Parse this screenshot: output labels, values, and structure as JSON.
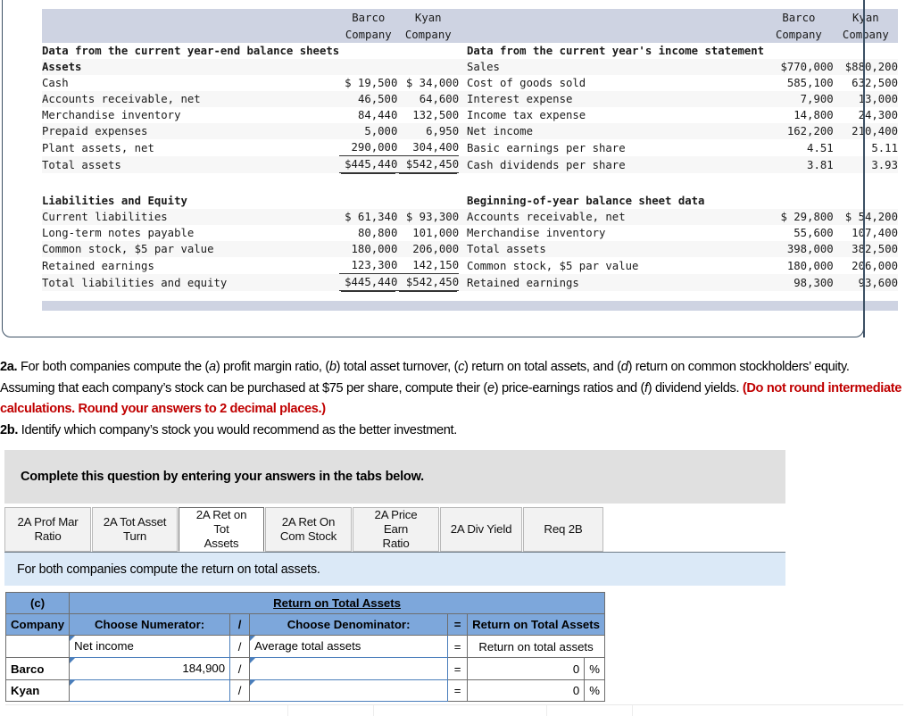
{
  "exhibit": {
    "col_headers": {
      "left_group": [
        {
          "line1": "Barco",
          "line2": "Company"
        },
        {
          "line1": "Kyan",
          "line2": "Company"
        }
      ],
      "right_group": [
        {
          "line1": "Barco",
          "line2": "Company"
        },
        {
          "line1": "Kyan",
          "line2": "Company"
        }
      ]
    },
    "left_section_title": "Data from the current year-end balance sheets",
    "right_section_title": "Data from the current year's income statement",
    "left_subtitle_assets": "Assets",
    "left_subtitle_liab": "Liabilities and Equity",
    "right_subtitle_begin": "Beginning-of-year balance sheet data",
    "assets_rows": [
      {
        "label": "Cash",
        "barco": "$ 19,500",
        "kyan": "$ 34,000"
      },
      {
        "label": "Accounts receivable, net",
        "barco": "46,500",
        "kyan": "64,600"
      },
      {
        "label": "Merchandise inventory",
        "barco": "84,440",
        "kyan": "132,500"
      },
      {
        "label": "Prepaid expenses",
        "barco": "5,000",
        "kyan": "6,950"
      },
      {
        "label": "Plant assets, net",
        "barco": "290,000",
        "kyan": "304,400"
      }
    ],
    "assets_total": {
      "label": "Total assets",
      "barco": "$445,440",
      "kyan": "$542,450"
    },
    "liab_rows": [
      {
        "label": "Current liabilities",
        "barco": "$ 61,340",
        "kyan": "$ 93,300"
      },
      {
        "label": "Long-term notes payable",
        "barco": "80,800",
        "kyan": "101,000"
      },
      {
        "label": "Common stock, $5 par value",
        "barco": "180,000",
        "kyan": "206,000"
      },
      {
        "label": "Retained earnings",
        "barco": "123,300",
        "kyan": "142,150"
      }
    ],
    "liab_total": {
      "label": "Total liabilities and equity",
      "barco": "$445,440",
      "kyan": "$542,450"
    },
    "income_rows": [
      {
        "label": "Sales",
        "barco": "$770,000",
        "kyan": "$880,200"
      },
      {
        "label": "Cost of goods sold",
        "barco": "585,100",
        "kyan": "632,500"
      },
      {
        "label": "Interest expense",
        "barco": "7,900",
        "kyan": "13,000"
      },
      {
        "label": "Income tax expense",
        "barco": "14,800",
        "kyan": "24,300"
      },
      {
        "label": "Net income",
        "barco": "162,200",
        "kyan": "210,400"
      },
      {
        "label": "Basic earnings per share",
        "barco": "4.51",
        "kyan": "5.11"
      },
      {
        "label": "Cash dividends per share",
        "barco": "3.81",
        "kyan": "3.93"
      }
    ],
    "begin_rows": [
      {
        "label": "Accounts receivable, net",
        "barco": "$ 29,800",
        "kyan": "$ 54,200"
      },
      {
        "label": "Merchandise inventory",
        "barco": "55,600",
        "kyan": "107,400"
      },
      {
        "label": "Total assets",
        "barco": "398,000",
        "kyan": "382,500"
      },
      {
        "label": "Common stock, $5 par value",
        "barco": "180,000",
        "kyan": "206,000"
      },
      {
        "label": "Retained earnings",
        "barco": "98,300",
        "kyan": "93,600"
      }
    ]
  },
  "question": {
    "q2a_label": "2a.",
    "q2a_text_1": " For both companies compute the (",
    "q2a_i_a": "a",
    "q2a_text_2": ") profit margin ratio, (",
    "q2a_i_b": "b",
    "q2a_text_3": ") total asset turnover, (",
    "q2a_i_c": "c",
    "q2a_text_4": ") return on total assets, and (",
    "q2a_i_d": "d",
    "q2a_text_5": ") return on common stockholders’ equity. Assuming that each company’s stock can be purchased at $75 per share, compute their (",
    "q2a_i_e": "e",
    "q2a_text_6": ") price-earnings ratios and (",
    "q2a_i_f": "f",
    "q2a_text_7": ") dividend yields. ",
    "q2a_warning": "(Do not round intermediate calculations. Round your answers to 2 decimal places.)",
    "q2b_label": "2b.",
    "q2b_text": " Identify which company’s stock you would recommend as the better investment."
  },
  "complete_banner": "Complete this question by entering your answers in the tabs below.",
  "tabs": [
    {
      "label": "2A Prof Mar Ratio",
      "line1": "2A Prof Mar",
      "line2": "Ratio",
      "active": false
    },
    {
      "label": "2A Tot Asset Turn",
      "line1": "2A Tot Asset",
      "line2": "Turn",
      "active": false
    },
    {
      "label": "2A Ret on Tot Assets",
      "line1": "2A Ret on Tot",
      "line2": "Assets",
      "active": true
    },
    {
      "label": "2A Ret On Com Stock",
      "line1": "2A Ret On",
      "line2": "Com Stock",
      "active": false
    },
    {
      "label": "2A Price Earn Ratio",
      "line1": "2A Price Earn",
      "line2": "Ratio",
      "active": false
    },
    {
      "label": "2A Div Yield",
      "line1": "2A Div Yield",
      "line2": "",
      "active": false
    },
    {
      "label": "Req 2B",
      "line1": "Req 2B",
      "line2": "",
      "active": false
    }
  ],
  "sub_instruction": "For both companies compute the return on total assets.",
  "answer_table": {
    "part_letter": "(c)",
    "title": "Return on Total Assets",
    "headers": {
      "company": "Company",
      "numerator": "Choose Numerator:",
      "slash": "/",
      "denominator": "Choose Denominator:",
      "equals": "=",
      "result": "Return on Total Assets"
    },
    "formula_row": {
      "company": "",
      "numerator": "Net income",
      "slash": "/",
      "denominator": "Average total assets",
      "equals": "=",
      "result": "Return on total assets"
    },
    "rows": [
      {
        "company": "Barco",
        "numerator": "184,900",
        "slash": "/",
        "denominator": "",
        "equals": "=",
        "result": "0",
        "pct": "%"
      },
      {
        "company": "Kyan",
        "numerator": "",
        "slash": "/",
        "denominator": "",
        "equals": "=",
        "result": "0",
        "pct": "%"
      }
    ]
  },
  "colors": {
    "header_band": "#ced3e2",
    "answer_header_blue": "#7da7db",
    "sub_instruction_blue": "#dbe9f7",
    "complete_gray": "#e0e0e0",
    "warning_red": "#c00000",
    "input_border_blue": "#4a7ebb",
    "panel_border": "#3c5064"
  }
}
